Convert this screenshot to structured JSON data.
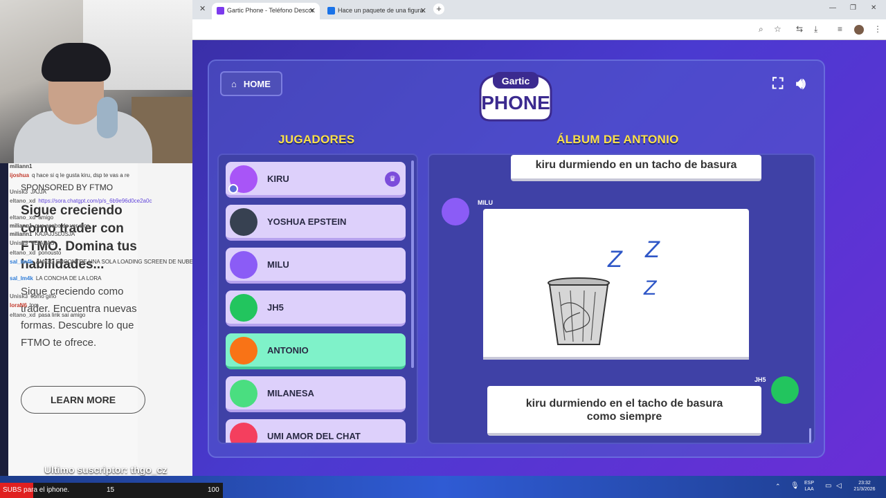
{
  "browser": {
    "tabs": [
      {
        "title": "Gartic Phone - Teléfono Descor",
        "active": true
      },
      {
        "title": "Hace un paquete de una figura",
        "active": false
      }
    ]
  },
  "game": {
    "home_label": "HOME",
    "logo_top": "Gartic",
    "logo_main": "PHONE",
    "players_title": "JUGADORES",
    "album_title": "ÁLBUM DE ANTONIO",
    "players": [
      {
        "name": "KIRU",
        "host": true,
        "color": "#a855f7"
      },
      {
        "name": "YOSHUA EPSTEIN",
        "host": false,
        "color": "#374151"
      },
      {
        "name": "MILU",
        "host": false,
        "color": "#8b5cf6"
      },
      {
        "name": "JH5",
        "host": false,
        "color": "#22c55e"
      },
      {
        "name": "ANTONIO",
        "host": false,
        "color": "#f97316",
        "active": true
      },
      {
        "name": "MILANESA",
        "host": false,
        "color": "#4ade80"
      },
      {
        "name": "UMI AMOR DEL CHAT",
        "host": false,
        "color": "#f43f5e"
      }
    ],
    "album": {
      "first_text": "kiru durmiendo en un tacho de basura",
      "drawing_author": "MILU",
      "drawing_zs": [
        "Z",
        "Z",
        "Z"
      ],
      "last_author": "JH5",
      "last_text_line1": "kiru durmiendo en el tacho de basura",
      "last_text_line2": "como siempre"
    }
  },
  "stream": {
    "ad": {
      "sponsor": "SPONSORED BY FTMO",
      "headline": "Sigue creciendo como trader con FTMO. Domina tus habilidades...",
      "body": "Sigue creciendo como trader. Encuentra nuevas formas. Descubre lo que FTMO te ofrece.",
      "cta": "LEARN MORE"
    },
    "chat": [
      {
        "user": "miliann1",
        "msg": ""
      },
      {
        "user": "ijoshua",
        "msg": "q hace si q le gusta kiru, dsp te vas a re"
      },
      {
        "user": "Unisk3",
        "msg": "JAJJA"
      },
      {
        "user": "eltano_xd",
        "msg": "https://sora.chatgpt.com/p/s_6b9e96d0ce2a0c"
      },
      {
        "user": "eltano_xd",
        "msg": "amigo"
      },
      {
        "user": "miliann1",
        "msg": "que acabo de ver dios"
      },
      {
        "user": "miliann1",
        "msg": "KAJAJJSDJSJA"
      },
      {
        "user": "Unisk3",
        "msg": "VEIASAS"
      },
      {
        "user": "eltano_xd",
        "msg": "ponousto"
      },
      {
        "user": "sal_lm4k",
        "msg": "AMIGO ENCONTRE UNA SOLA LOADING SCREEN DE NUBES"
      },
      {
        "user": "sal_lm4k",
        "msg": "LA CONCHA DE LA LORA"
      },
      {
        "user": "Unisk3",
        "msg": "como giño"
      },
      {
        "user": "loraN6",
        "msg": "lpm"
      },
      {
        "user": "eltano_xd",
        "msg": "pasa link sai amigo"
      }
    ],
    "last_sub_label": "Ultimo suscriptor:",
    "last_sub_name": "thgo_cz",
    "subs_goal": {
      "label": "SUBS para el iphone.",
      "current": "15",
      "goal": "100"
    }
  },
  "taskbar": {
    "lang": "ESP",
    "lang_sub": "LAA",
    "time": "23:32",
    "date": "21/3/2026"
  }
}
